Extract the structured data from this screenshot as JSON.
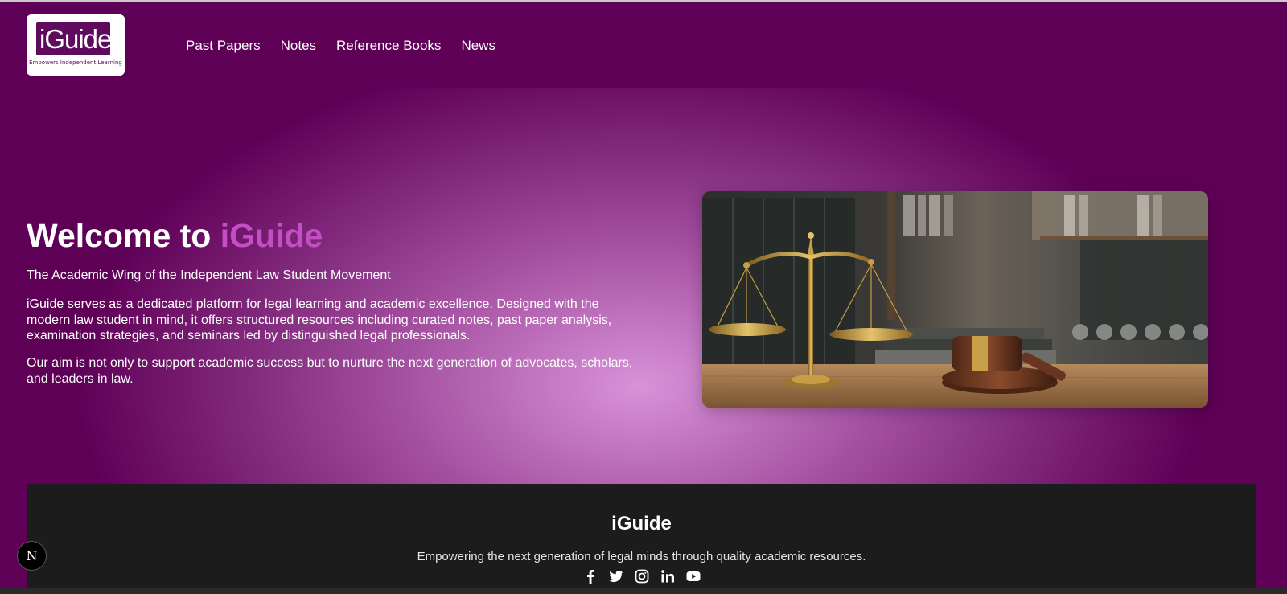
{
  "header": {
    "logo": {
      "text": "iGuide",
      "tagline": "Empowers Independent Learning"
    },
    "nav": [
      "Past Papers",
      "Notes",
      "Reference Books",
      "News"
    ]
  },
  "hero": {
    "title_prefix": "Welcome to ",
    "title_brand": "iGuide",
    "subtitle": "The Academic Wing of the Independent Law Student Movement",
    "paragraph1": "iGuide serves as a dedicated platform for legal learning and academic excellence. Designed with the modern law student in mind, it offers structured resources including curated notes, past paper analysis, examination strategies, and seminars led by distinguished legal professionals.",
    "paragraph2": "Our aim is not only to support academic success but to nurture the next generation of advocates, scholars, and leaders in law.",
    "image": "scales-of-justice-and-gavel-photo"
  },
  "footer": {
    "title": "iGuide",
    "tagline": "Empowering the next generation of legal minds through quality academic resources.",
    "social": [
      "facebook-icon",
      "twitter-icon",
      "instagram-icon",
      "linkedin-icon",
      "youtube-icon"
    ]
  },
  "dev_badge": {
    "letter": "N"
  },
  "colors": {
    "primary": "#5f0057",
    "brand_accent": "#c44fc4",
    "footer_bg": "#1c1c1c",
    "hero_glow": "#d892d8"
  }
}
